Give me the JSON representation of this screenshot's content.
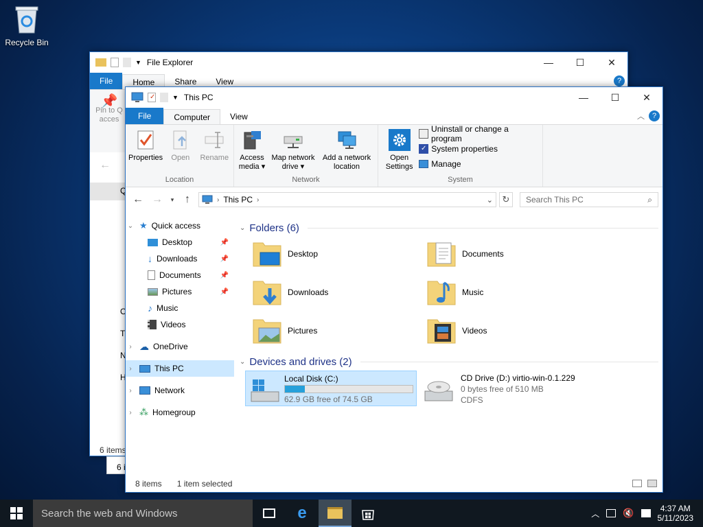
{
  "desktop": {
    "recycle_bin": "Recycle Bin"
  },
  "back_window": {
    "title": "File Explorer",
    "tabs": [
      "File",
      "Home",
      "Share",
      "View"
    ],
    "pin_label_1": "Pin to Q",
    "pin_label_2": "acces",
    "nav_letters": [
      "Q",
      "O",
      "T",
      "N",
      "H"
    ],
    "status": "6 items",
    "status2": "6 i"
  },
  "front_window": {
    "title": "This PC",
    "tabs": {
      "file": "File",
      "computer": "Computer",
      "view": "View"
    },
    "ribbon": {
      "location": {
        "name": "Location",
        "properties": "Properties",
        "open": "Open",
        "rename": "Rename"
      },
      "network": {
        "name": "Network",
        "access_media_1": "Access",
        "access_media_2": "media ▾",
        "map_drive_1": "Map network",
        "map_drive_2": "drive ▾",
        "add_location_1": "Add a network",
        "add_location_2": "location"
      },
      "system": {
        "name": "System",
        "open_settings_1": "Open",
        "open_settings_2": "Settings",
        "uninstall": "Uninstall or change a program",
        "sys_props": "System properties",
        "manage": "Manage"
      }
    },
    "address": {
      "path": "This PC",
      "search_placeholder": "Search This PC"
    },
    "nav": {
      "quick_access": "Quick access",
      "desktop": "Desktop",
      "downloads": "Downloads",
      "documents": "Documents",
      "pictures": "Pictures",
      "music": "Music",
      "videos": "Videos",
      "onedrive": "OneDrive",
      "this_pc": "This PC",
      "network": "Network",
      "homegroup": "Homegroup"
    },
    "folders_header": "Folders (6)",
    "folders": [
      "Desktop",
      "Documents",
      "Downloads",
      "Music",
      "Pictures",
      "Videos"
    ],
    "devices_header": "Devices and drives (2)",
    "drives": {
      "c_name": "Local Disk (C:)",
      "c_free": "62.9 GB free of 74.5 GB",
      "c_used_fraction": 0.156,
      "d_name": "CD Drive (D:) virtio-win-0.1.229",
      "d_free": "0 bytes free of 510 MB",
      "d_fs": "CDFS"
    },
    "status": {
      "items": "8 items",
      "selected": "1 item selected"
    }
  },
  "taskbar": {
    "search": "Search the web and Windows",
    "time": "4:37 AM",
    "date": "5/11/2023"
  },
  "colors": {
    "accent": "#1979ca",
    "selection": "#cce8ff",
    "header_blue": "#1e3287"
  }
}
